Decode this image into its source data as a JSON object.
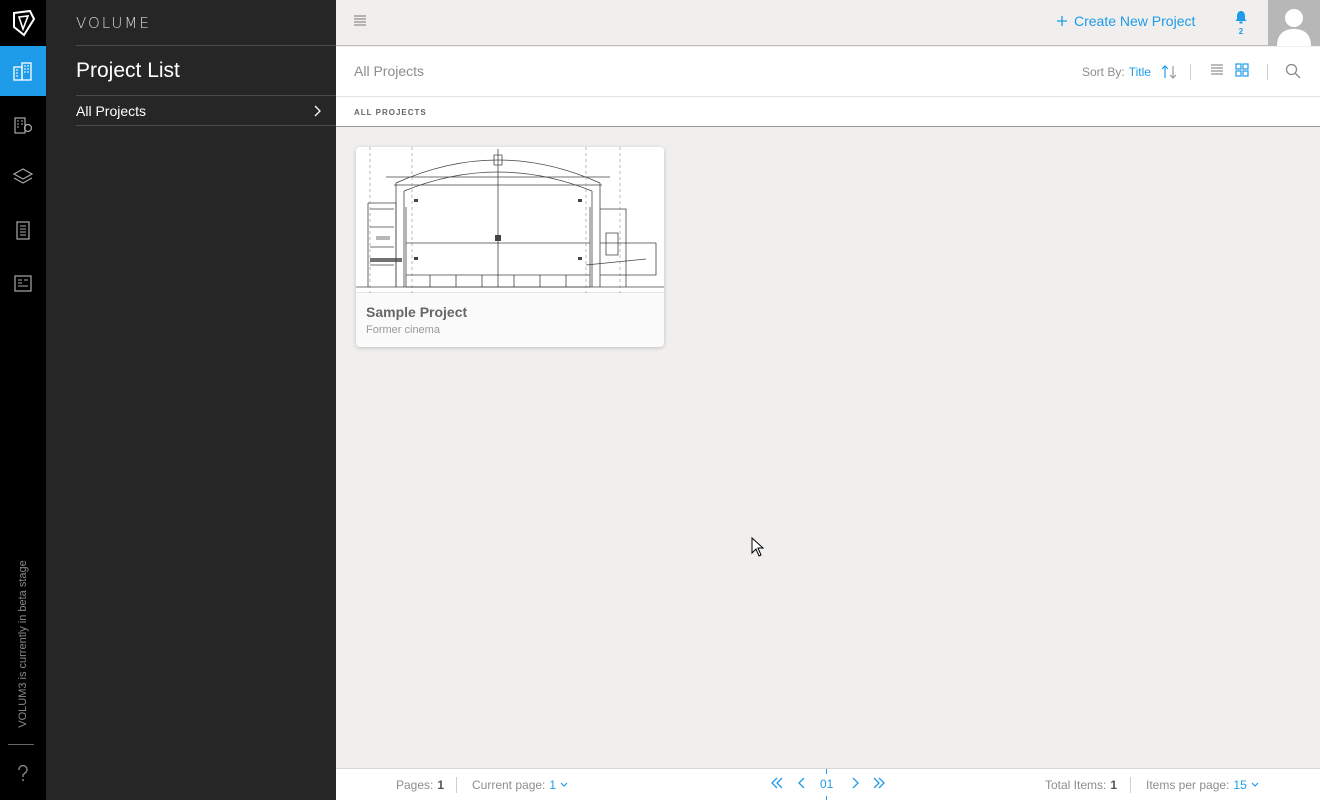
{
  "app": {
    "brand": "VOLUME"
  },
  "rail": {
    "items": [
      "projects-icon",
      "buildings-icon",
      "layers-icon",
      "checklist-icon",
      "reports-icon"
    ],
    "beta_text": "VOLUM3 is currently in beta stage",
    "accent": "#1e9be9"
  },
  "sidebar": {
    "title": "Project List",
    "items": [
      {
        "label": "All Projects"
      }
    ]
  },
  "topbar": {
    "create_label": "Create New Project",
    "notifications_count": "2"
  },
  "subheader": {
    "breadcrumb": "All Projects",
    "sort_label": "Sort By:",
    "sort_value": "Title"
  },
  "section": {
    "label": "ALL PROJECTS"
  },
  "projects": [
    {
      "name": "Sample Project",
      "description": "Former cinema"
    }
  ],
  "footer": {
    "pages_label": "Pages:",
    "pages_value": "1",
    "current_label": "Current page:",
    "current_value": "1",
    "page_number": "01",
    "total_label": "Total Items:",
    "total_value": "1",
    "per_page_label": "Items per page:",
    "per_page_value": "15"
  }
}
